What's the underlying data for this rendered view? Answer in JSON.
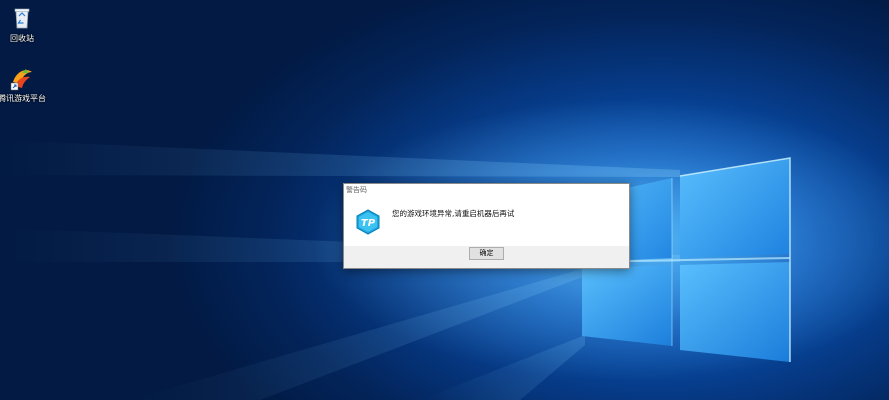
{
  "desktop": {
    "icons": [
      {
        "label": "回收站",
        "icon": "recycle-bin-icon"
      },
      {
        "label": "腾讯游戏平台",
        "icon": "tencent-game-platform-icon"
      }
    ]
  },
  "dialog": {
    "title": "警告码",
    "message": "您的游戏环境异常,请重启机器后再试",
    "ok_label": "确定",
    "icon": "tgp-logo-icon"
  },
  "colors": {
    "wallpaper": "#0a56b8",
    "windows_logo": "#7fd2ff",
    "dialog_bg": "#ffffff",
    "dialog_footer": "#f0f0f0"
  }
}
